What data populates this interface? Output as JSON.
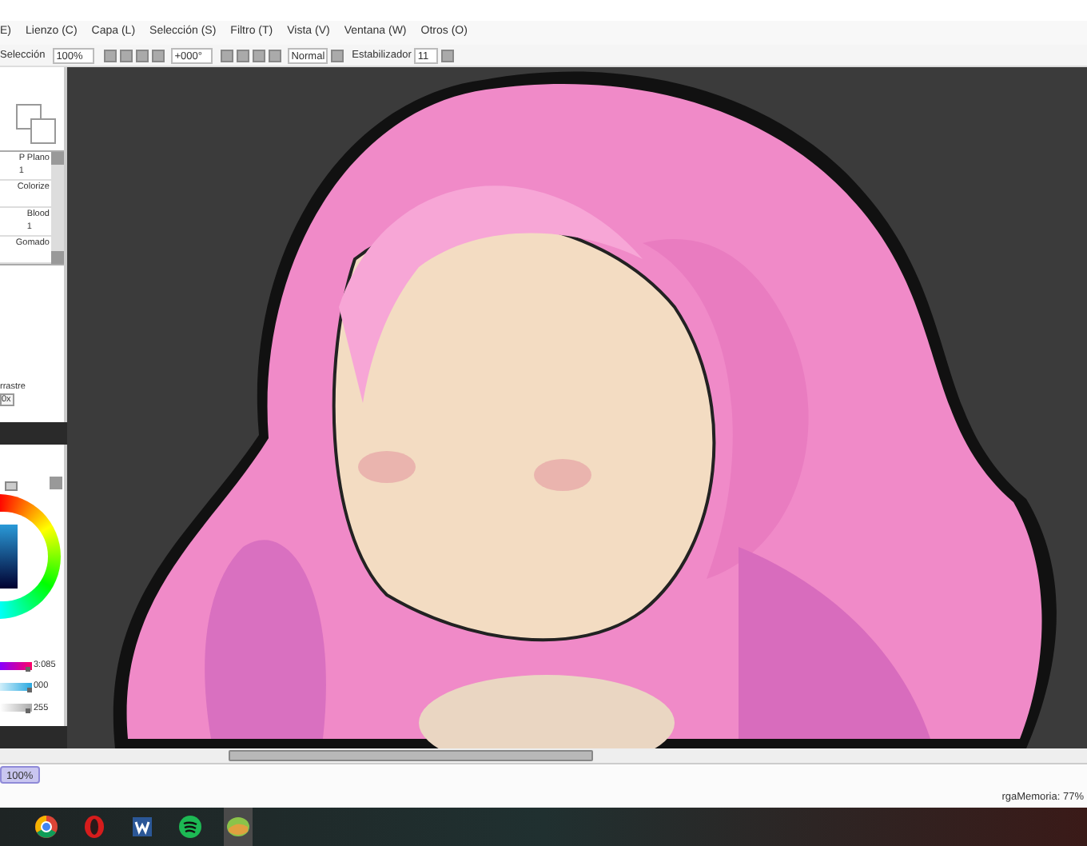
{
  "menu": [
    "E)",
    "Lienzo (C)",
    "Capa (L)",
    "Selección (S)",
    "Filtro (T)",
    "Vista (V)",
    "Ventana (W)",
    "Otros (O)"
  ],
  "toolbar": {
    "selection_label": "Selección",
    "zoom_value": "100%",
    "rotation_value": "+000°",
    "blend_mode": "Normal",
    "stabilizer_label": "Estabilizador",
    "stabilizer_value": "11"
  },
  "brushes": [
    {
      "name": "P Plano",
      "size": "1"
    },
    {
      "name": "Colorize"
    },
    {
      "name": "Blood",
      "size": "1"
    },
    {
      "name": "Gomado"
    }
  ],
  "tool_options": {
    "label": "rrastre",
    "button": "0x"
  },
  "color_sliders": [
    {
      "kind": "hue",
      "level": 0.92,
      "reading": "3:085"
    },
    {
      "kind": "saturation",
      "level": 0.95,
      "reading": "000"
    },
    {
      "kind": "value",
      "level": 0.9,
      "reading": "255"
    }
  ],
  "status_bar": {
    "tab": "100%",
    "memory": "rgaMemoria: 77%"
  },
  "taskbar": [
    {
      "kind": "chrome",
      "selected": false
    },
    {
      "kind": "opera",
      "selected": false
    },
    {
      "kind": "word",
      "selected": false
    },
    {
      "kind": "spotify",
      "selected": false
    },
    {
      "kind": "sai",
      "selected": true
    }
  ]
}
